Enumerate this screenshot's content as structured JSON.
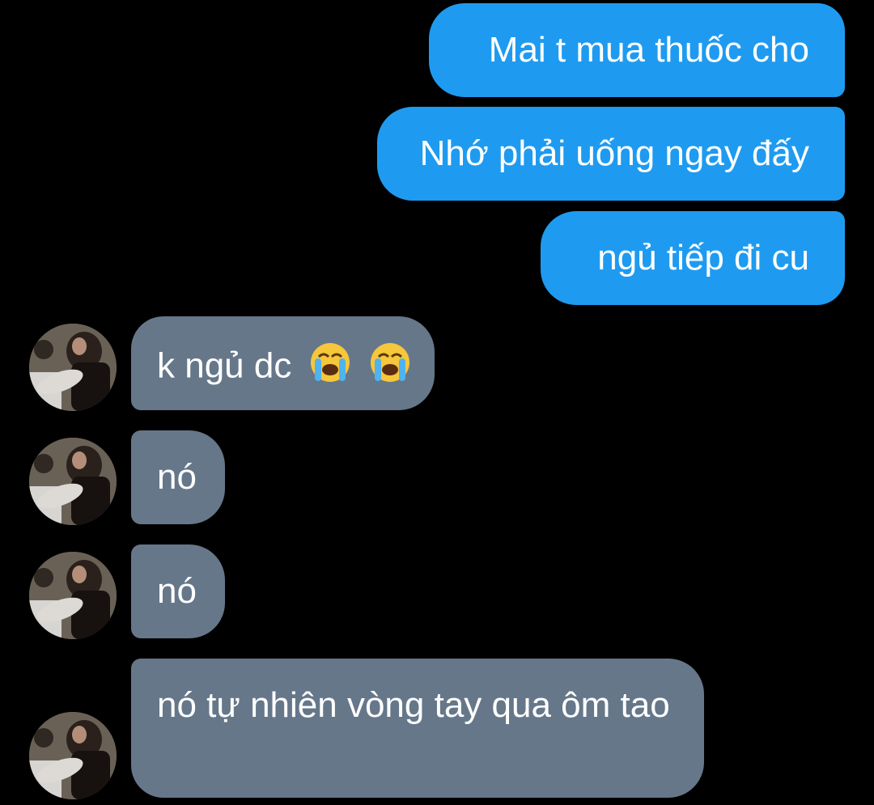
{
  "conversation": {
    "sent": [
      {
        "text": "Mai t mua thuốc cho"
      },
      {
        "text": "Nhớ phải uống ngay đấy"
      },
      {
        "text": "ngủ tiếp đi cu"
      }
    ],
    "received": [
      {
        "text": "k ngủ dc",
        "emojis": [
          "loudly-crying-face",
          "loudly-crying-face"
        ]
      },
      {
        "text": "nó"
      },
      {
        "text": "nó"
      },
      {
        "text": "nó tự nhiên vòng tay qua ôm tao"
      }
    ]
  },
  "colors": {
    "background": "#000000",
    "sent_bubble": "#1e9bf0",
    "received_bubble": "#66778a",
    "text": "#ffffff"
  }
}
